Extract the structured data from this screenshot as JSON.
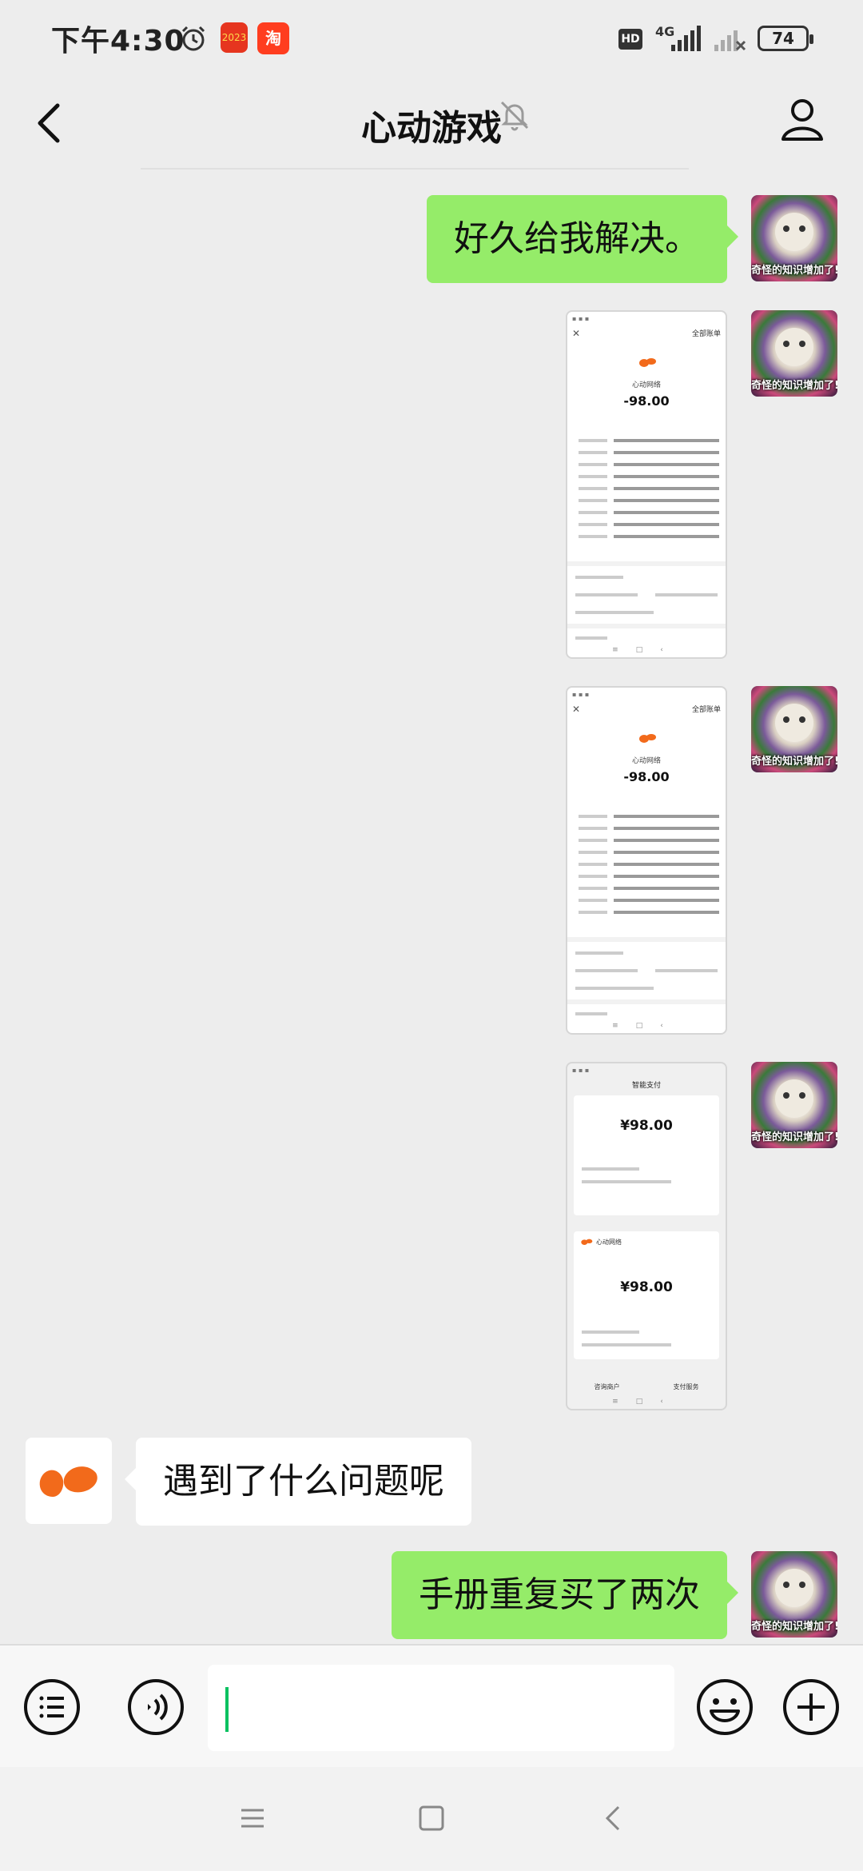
{
  "status_bar": {
    "time": "下午4:30",
    "app1_label": "2023",
    "app2_label": "淘",
    "hd_label": "HD",
    "network": "4G",
    "battery": "74"
  },
  "header": {
    "title": "心动游戏",
    "icons": {
      "back": "back-chevron-icon",
      "mute": "mute-bell-icon",
      "profile": "person-icon"
    }
  },
  "avatar": {
    "caption": "奇怪的知识增加了!"
  },
  "messages": [
    {
      "type": "text",
      "direction": "out",
      "text": "好久给我解决。"
    },
    {
      "type": "image",
      "direction": "out",
      "kind": "bill-detail",
      "merchant": "心动网络",
      "amount": "-98.00",
      "bill_label": "全部账单"
    },
    {
      "type": "image",
      "direction": "out",
      "kind": "bill-detail",
      "merchant": "心动网络",
      "amount": "-98.00",
      "bill_label": "全部账单"
    },
    {
      "type": "image",
      "direction": "out",
      "kind": "payment",
      "header": "智能支付",
      "amount1": "¥98.00",
      "merchant2": "心动网络",
      "amount2": "¥98.00",
      "footer_left": "咨询商户",
      "footer_right": "支付服务"
    },
    {
      "type": "text",
      "direction": "in",
      "text": "遇到了什么问题呢"
    },
    {
      "type": "text",
      "direction": "out",
      "text": "手册重复买了两次"
    }
  ],
  "input_bar": {
    "icons": [
      "menu-list-icon",
      "voice-icon",
      "emoji-icon",
      "plus-icon"
    ],
    "value": ""
  },
  "colors": {
    "outgoing_bubble": "#95ec69",
    "incoming_bubble": "#ffffff",
    "background": "#ededed",
    "brand_orange": "#f26a1b",
    "cursor": "#07c160"
  }
}
